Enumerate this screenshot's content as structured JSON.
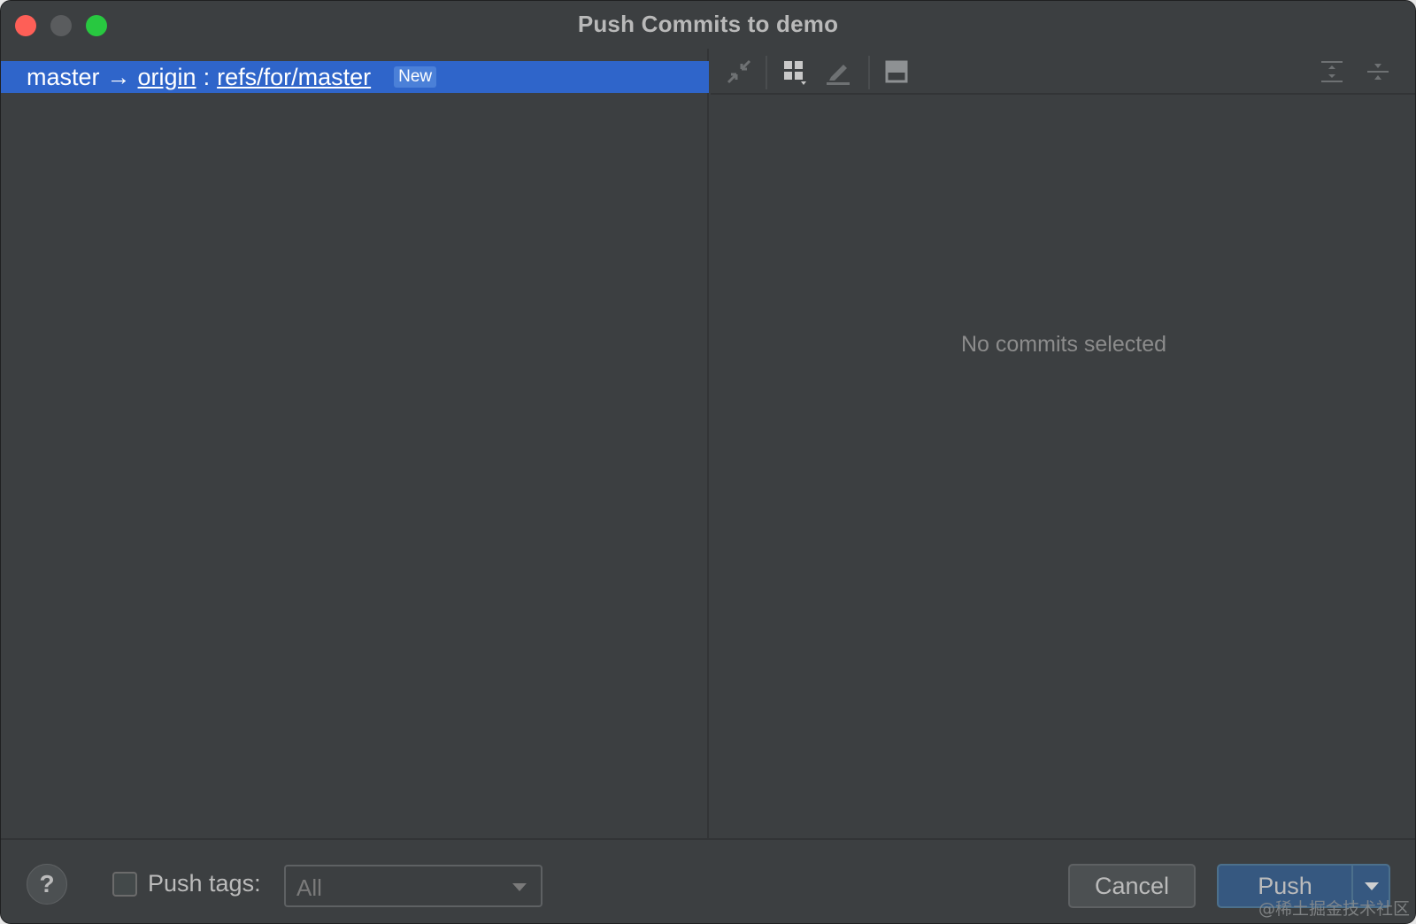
{
  "window": {
    "title": "Push Commits to demo"
  },
  "branch_row": {
    "local_branch": "master",
    "arrow": "→",
    "remote": "origin",
    "separator": ":",
    "target_ref": "refs/for/master",
    "badge": "New"
  },
  "details": {
    "empty_message": "No commits selected"
  },
  "toolbar": {
    "icons": [
      "collapse-icon",
      "group-by-icon",
      "edit-icon",
      "preview-icon",
      "expand-all-icon",
      "collapse-all-icon"
    ]
  },
  "footer": {
    "help_label": "?",
    "push_tags_label": "Push tags:",
    "push_tags_checked": false,
    "tags_select_value": "All",
    "cancel_label": "Cancel",
    "push_label": "Push"
  },
  "watermark": "@稀土掘金技术社区",
  "colors": {
    "selection": "#2f65ca",
    "background": "#3c3f41",
    "push_button": "#365880",
    "close": "#fe5f57",
    "maximize": "#28c840"
  }
}
